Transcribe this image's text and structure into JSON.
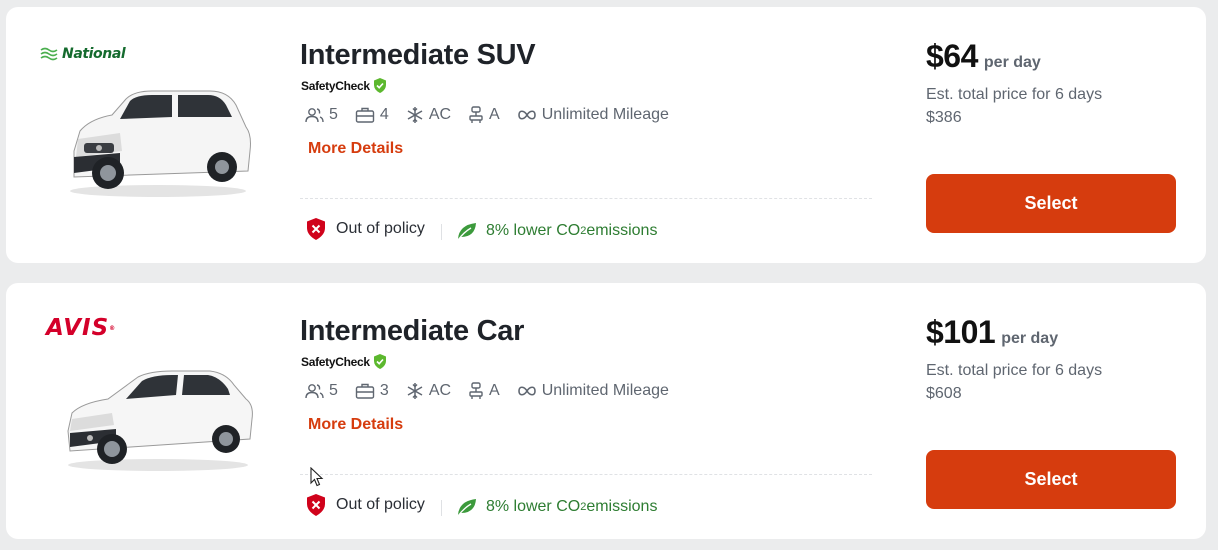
{
  "listings": [
    {
      "vendor": "National",
      "car_title": "Intermediate SUV",
      "safety_label": "SafetyCheck",
      "features": {
        "passengers": "5",
        "bags": "4",
        "ac": "AC",
        "transmission": "A",
        "mileage": "Unlimited Mileage"
      },
      "more_details": "More Details",
      "policy": "Out of policy",
      "co2_prefix": "8% lower CO",
      "co2_sub": "2",
      "co2_suffix": " emissions",
      "price": "$64",
      "per_day": "per day",
      "total_label": "Est. total price for 6 days",
      "total_value": "$386",
      "select_label": "Select",
      "car_color": "#f3f3f3"
    },
    {
      "vendor": "AVIS",
      "car_title": "Intermediate Car",
      "safety_label": "SafetyCheck",
      "features": {
        "passengers": "5",
        "bags": "3",
        "ac": "AC",
        "transmission": "A",
        "mileage": "Unlimited Mileage"
      },
      "more_details": "More Details",
      "policy": "Out of policy",
      "co2_prefix": "8% lower CO",
      "co2_sub": "2",
      "co2_suffix": " emissions",
      "price": "$101",
      "per_day": "per day",
      "total_label": "Est. total price for 6 days",
      "total_value": "$608",
      "select_label": "Select",
      "car_color": "#f3f3f3"
    }
  ],
  "colors": {
    "accent": "#d63c0e",
    "policy_red": "#d0021b",
    "eco_green": "#2e7d32",
    "safety_green": "#5cb82e",
    "national_green": "#156b2e",
    "avis_red": "#d4002a"
  },
  "icons": {
    "passengers": "people-icon",
    "bags": "briefcase-icon",
    "ac": "snowflake-icon",
    "transmission": "gear-shift-icon",
    "mileage": "infinity-icon",
    "safety": "shield-check-icon",
    "policy": "shield-x-icon",
    "co2": "leaf-icon"
  }
}
